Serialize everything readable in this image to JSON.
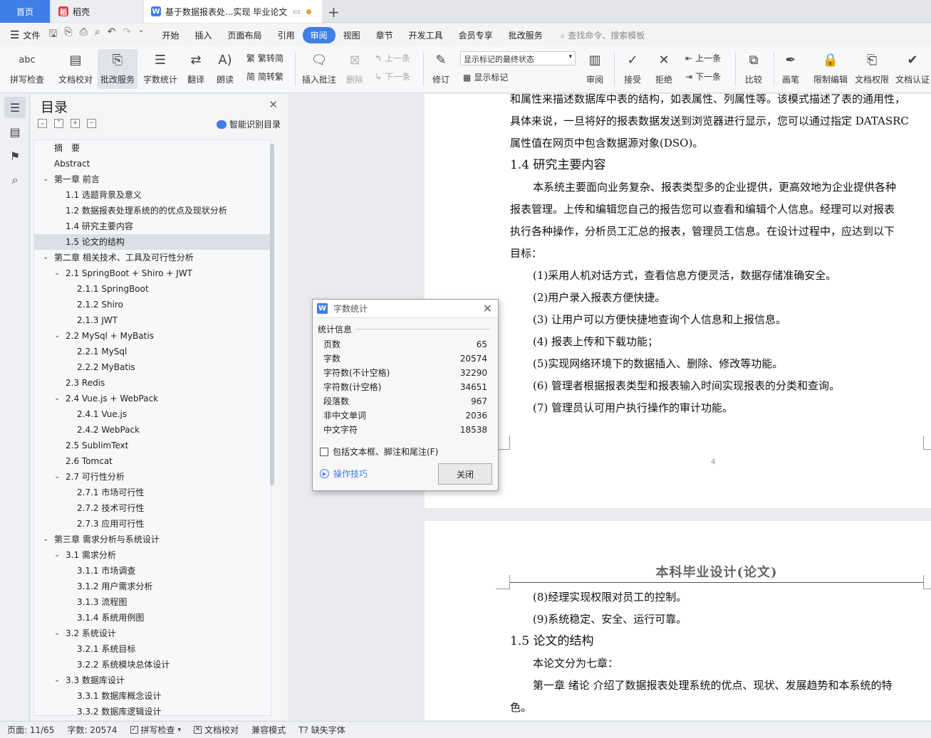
{
  "tabs": {
    "home": "首页",
    "daoke": "稻壳",
    "doc": "基于数据报表处...实现 毕业论文"
  },
  "menu": {
    "file": "文件",
    "tabs": [
      "开始",
      "插入",
      "页面布局",
      "引用",
      "审阅",
      "视图",
      "章节",
      "开发工具",
      "会员专享",
      "批改服务"
    ],
    "active_tab": "审阅",
    "search": "查找命令、搜索模板"
  },
  "ribbon": {
    "spell": "拼写检查",
    "proof": "文档校对",
    "correct": "批改服务",
    "wordcount": "字数统计",
    "translate": "翻译",
    "read": "朗读",
    "trad": "繁转简",
    "simp": "简转繁",
    "insert_comment": "插入批注",
    "delete": "删除",
    "prev_comment": "上一条",
    "next_comment": "下一条",
    "revise": "修订",
    "markup_select": "显示标记的最终状态",
    "show_markup": "显示标记",
    "review": "审阅",
    "accept": "接受",
    "reject": "拒绝",
    "prev": "上一条",
    "next": "下一条",
    "compare": "比较",
    "pen": "画笔",
    "restrict": "限制编辑",
    "perm": "文档权限",
    "cert": "文档认证"
  },
  "toc": {
    "title": "目录",
    "smart": "智能识别目录",
    "items": [
      {
        "label": "摘　要",
        "level": 1,
        "caret": false
      },
      {
        "label": "Abstract",
        "level": 1,
        "caret": false
      },
      {
        "label": "第一章  前言",
        "level": 1,
        "caret": true
      },
      {
        "label": "1.1 选题背景及意义",
        "level": 2,
        "caret": false
      },
      {
        "label": "1.2  数据报表处理系统的的优点及现状分析",
        "level": 2,
        "caret": false
      },
      {
        "label": "1.4  研究主要内容",
        "level": 2,
        "caret": false
      },
      {
        "label": "1.5  论文的结构",
        "level": 2,
        "caret": false,
        "selected": true
      },
      {
        "label": "第二章  相关技术、工具及可行性分析",
        "level": 1,
        "caret": true
      },
      {
        "label": "2.1 SpringBoot + Shiro + JWT",
        "level": 2,
        "caret": true
      },
      {
        "label": "2.1.1 SpringBoot",
        "level": 3,
        "caret": false
      },
      {
        "label": "2.1.2 Shiro",
        "level": 3,
        "caret": false
      },
      {
        "label": "2.1.3 JWT",
        "level": 3,
        "caret": false
      },
      {
        "label": "2.2 MySql + MyBatis",
        "level": 2,
        "caret": true
      },
      {
        "label": "2.2.1 MySql",
        "level": 3,
        "caret": false
      },
      {
        "label": "2.2.2 MyBatis",
        "level": 3,
        "caret": false
      },
      {
        "label": "2.3 Redis",
        "level": 2,
        "caret": false
      },
      {
        "label": "2.4 Vue.js + WebPack",
        "level": 2,
        "caret": true
      },
      {
        "label": "2.4.1 Vue.js",
        "level": 3,
        "caret": false
      },
      {
        "label": "2.4.2 WebPack",
        "level": 3,
        "caret": false
      },
      {
        "label": "2.5 SublimText",
        "level": 2,
        "caret": false
      },
      {
        "label": "2.6 Tomcat",
        "level": 2,
        "caret": false
      },
      {
        "label": "2.7  可行性分析",
        "level": 2,
        "caret": true
      },
      {
        "label": "2.7.1  市场可行性",
        "level": 3,
        "caret": false
      },
      {
        "label": "2.7.2  技术可行性",
        "level": 3,
        "caret": false
      },
      {
        "label": "2.7.3  应用可行性",
        "level": 3,
        "caret": false
      },
      {
        "label": "第三章  需求分析与系统设计",
        "level": 1,
        "caret": true
      },
      {
        "label": "3.1  需求分析",
        "level": 2,
        "caret": true
      },
      {
        "label": "3.1.1 市场调查",
        "level": 3,
        "caret": false
      },
      {
        "label": "3.1.2  用户需求分析",
        "level": 3,
        "caret": false
      },
      {
        "label": "3.1.3  流程图",
        "level": 3,
        "caret": false
      },
      {
        "label": "3.1.4  系统用例图",
        "level": 3,
        "caret": false
      },
      {
        "label": "3.2  系统设计",
        "level": 2,
        "caret": true
      },
      {
        "label": "3.2.1  系统目标",
        "level": 3,
        "caret": false
      },
      {
        "label": "3.2.2  系统模块总体设计",
        "level": 3,
        "caret": false
      },
      {
        "label": "3.3  数据库设计",
        "level": 2,
        "caret": true
      },
      {
        "label": "3.3.1  数据库概念设计",
        "level": 3,
        "caret": false
      },
      {
        "label": "3.3.2  数据库逻辑设计",
        "level": 3,
        "caret": false
      }
    ]
  },
  "page1": {
    "lines": [
      {
        "text": "和属性来描述数据库中表的结构，如表属性、列属性等。该模式描述了表的通用性，",
        "indent": false,
        "heading": false
      },
      {
        "text": "具体来说，一旦将好的报表数据发送到浏览器进行显示，您可以通过指定 DATASRC",
        "indent": false,
        "heading": false
      },
      {
        "text": "属性值在网页中包含数据源对象(DSO)。",
        "indent": false,
        "heading": false
      },
      {
        "text": "1.4  研究主要内容",
        "indent": false,
        "heading": true
      },
      {
        "text": "本系统主要面向业务复杂、报表类型多的企业提供，更高效地为企业提供各种",
        "indent": true,
        "heading": false
      },
      {
        "text": "报表管理。上传和编辑您自己的报告您可以查看和编辑个人信息。经理可以对报表",
        "indent": false,
        "heading": false
      },
      {
        "text": "执行各种操作，分析员工汇总的报表，管理员工信息。在设计过程中，应达到以下",
        "indent": false,
        "heading": false
      },
      {
        "text": "目标：",
        "indent": false,
        "heading": false
      },
      {
        "text": "(1)采用人机对话方式，查看信息方便灵活，数据存储准确安全。",
        "indent": true,
        "heading": false
      },
      {
        "text": "(2)用户录入报表方便快捷。",
        "indent": true,
        "heading": false
      },
      {
        "text": "(3)  让用户可以方便快捷地查询个人信息和上报信息。",
        "indent": true,
        "heading": false
      },
      {
        "text": "(4)  报表上传和下载功能；",
        "indent": true,
        "heading": false
      },
      {
        "text": "(5)实现网络环境下的数据插入、删除、修改等功能。",
        "indent": true,
        "heading": false
      },
      {
        "text": "(6)  管理者根据报表类型和报表输入时间实现报表的分类和查询。",
        "indent": true,
        "heading": false
      },
      {
        "text": "(7)  管理员认可用户执行操作的审计功能。",
        "indent": true,
        "heading": false
      }
    ],
    "page_number": "4"
  },
  "page2": {
    "header": "本科毕业设计(论文)",
    "lines": [
      {
        "text": "(8)经理实现权限对员工的控制。",
        "indent": true,
        "heading": false
      },
      {
        "text": "(9)系统稳定、安全、运行可靠。",
        "indent": true,
        "heading": false
      },
      {
        "text": "1.5  论文的结构",
        "indent": false,
        "heading": true
      },
      {
        "text": "本论文分为七章：",
        "indent": true,
        "heading": false
      },
      {
        "text": "第一章  绪论  介绍了数据报表处理系统的优点、现状、发展趋势和本系统的特",
        "indent": true,
        "heading": false
      },
      {
        "text": "色。",
        "indent": false,
        "heading": false
      }
    ]
  },
  "dialog": {
    "title": "字数统计",
    "section": "统计信息",
    "stats": [
      {
        "label": "页数",
        "value": "65"
      },
      {
        "label": "字数",
        "value": "20574"
      },
      {
        "label": "字符数(不计空格)",
        "value": "32290"
      },
      {
        "label": "字符数(计空格)",
        "value": "34651"
      },
      {
        "label": "段落数",
        "value": "967"
      },
      {
        "label": "非中文单词",
        "value": "2036"
      },
      {
        "label": "中文字符",
        "value": "18538"
      }
    ],
    "checkbox": "包括文本框、脚注和尾注(F)",
    "tips": "操作技巧",
    "close": "关闭"
  },
  "status": {
    "page": "页面: 11/65",
    "words": "字数: 20574",
    "spell": "拼写检查",
    "proof": "文档校对",
    "compat": "兼容模式",
    "missing_font": "缺失字体"
  }
}
